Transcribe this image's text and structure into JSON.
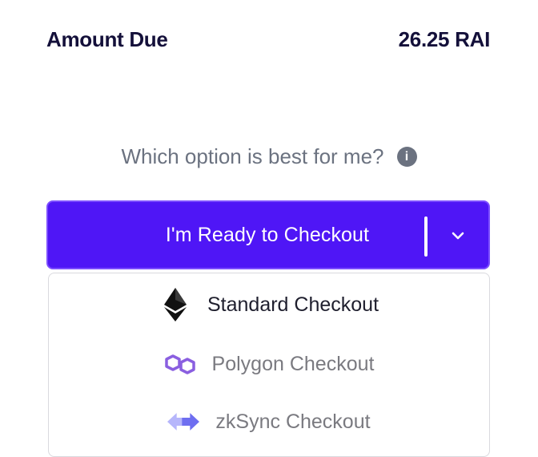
{
  "amount": {
    "label": "Amount Due",
    "value": "26.25 RAI"
  },
  "help": {
    "text": "Which option is best for me?",
    "icon": "info-icon"
  },
  "checkout_button": {
    "label": "I'm Ready to Checkout",
    "dropdown_icon": "chevron-down-icon"
  },
  "checkout_options": [
    {
      "label": "Standard Checkout",
      "icon": "ethereum-icon"
    },
    {
      "label": "Polygon Checkout",
      "icon": "polygon-icon"
    },
    {
      "label": "zkSync Checkout",
      "icon": "zksync-icon"
    }
  ],
  "colors": {
    "primary": "#4f16f6",
    "text_dark": "#14103a",
    "text_muted": "#6b7280",
    "polygon": "#8a5fe0",
    "zksync": "#8c8dfc"
  }
}
